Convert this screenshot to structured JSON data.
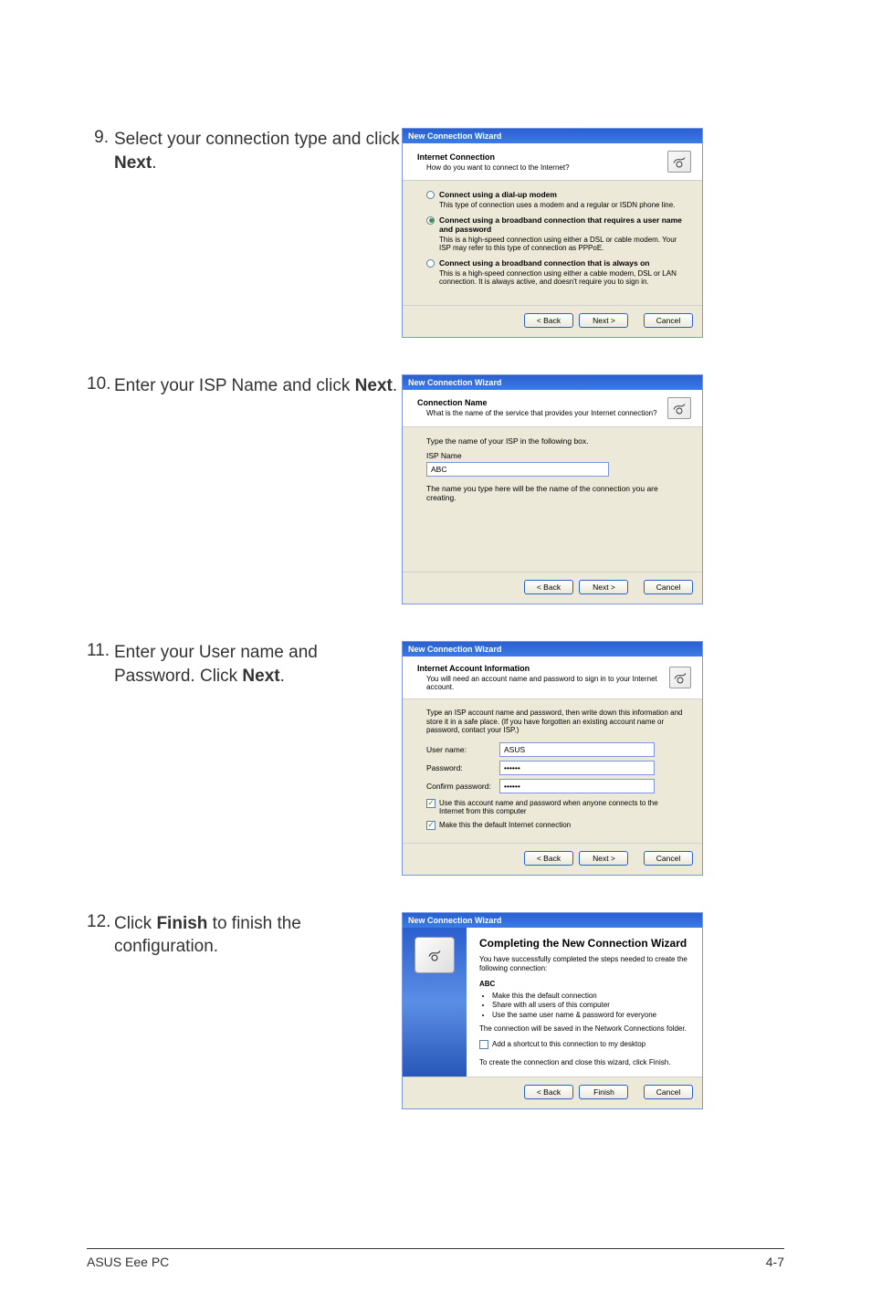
{
  "steps": {
    "s9": {
      "num": "9.",
      "text_before": "Select your connection type and click ",
      "bold": "Next",
      "text_after": "."
    },
    "s10": {
      "num": "10.",
      "text_before": "Enter your ISP Name and click ",
      "bold": "Next",
      "text_after": "."
    },
    "s11": {
      "num": "11.",
      "text_before": "Enter your User name and Password. Click ",
      "bold": "Next",
      "text_after": "."
    },
    "s12": {
      "num": "12.",
      "text_before": "Click ",
      "bold": "Finish",
      "text_after": " to finish the configuration."
    }
  },
  "wizard9": {
    "window_title": "New Connection Wizard",
    "header_title": "Internet Connection",
    "header_sub": "How do you want to connect to the Internet?",
    "opt1_label": "Connect using a dial-up modem",
    "opt1_desc": "This type of connection uses a modem and a regular or ISDN phone line.",
    "opt2_label": "Connect using a broadband connection that requires a user name and password",
    "opt2_desc": "This is a high-speed connection using either a DSL or cable modem. Your ISP may refer to this type of connection as PPPoE.",
    "opt3_label": "Connect using a broadband connection that is always on",
    "opt3_desc": "This is a high-speed connection using either a cable modem, DSL or LAN connection. It is always active, and doesn't require you to sign in.",
    "btn_back": "< Back",
    "btn_next": "Next >",
    "btn_cancel": "Cancel"
  },
  "wizard10": {
    "window_title": "New Connection Wizard",
    "header_title": "Connection Name",
    "header_sub": "What is the name of the service that provides your Internet connection?",
    "instruction": "Type the name of your ISP in the following box.",
    "label": "ISP Name",
    "value": "ABC",
    "hint": "The name you type here will be the name of the connection you are creating.",
    "btn_back": "< Back",
    "btn_next": "Next >",
    "btn_cancel": "Cancel"
  },
  "wizard11": {
    "window_title": "New Connection Wizard",
    "header_title": "Internet Account Information",
    "header_sub": "You will need an account name and password to sign in to your Internet account.",
    "instruction": "Type an ISP account name and password, then write down this information and store it in a safe place. (If you have forgotten an existing account name or password, contact your ISP.)",
    "lbl_user": "User name:",
    "val_user": "ASUS",
    "lbl_pass": "Password:",
    "val_pass": "••••••",
    "lbl_confirm": "Confirm password:",
    "val_confirm": "••••••",
    "chk1": "Use this account name and password when anyone connects to the Internet from this computer",
    "chk2": "Make this the default Internet connection",
    "btn_back": "< Back",
    "btn_next": "Next >",
    "btn_cancel": "Cancel"
  },
  "wizard12": {
    "window_title": "New Connection Wizard",
    "heading": "Completing the New Connection Wizard",
    "p1": "You have successfully completed the steps needed to create the following connection:",
    "conn": "ABC",
    "bullets": [
      "Make this the default connection",
      "Share with all users of this computer",
      "Use the same user name & password for everyone"
    ],
    "p2": "The connection will be saved in the Network Connections folder.",
    "chk": "Add a shortcut to this connection to my desktop",
    "p3": "To create the connection and close this wizard, click Finish.",
    "btn_back": "< Back",
    "btn_finish": "Finish",
    "btn_cancel": "Cancel"
  },
  "footer": {
    "left": "ASUS Eee PC",
    "right": "4-7"
  }
}
